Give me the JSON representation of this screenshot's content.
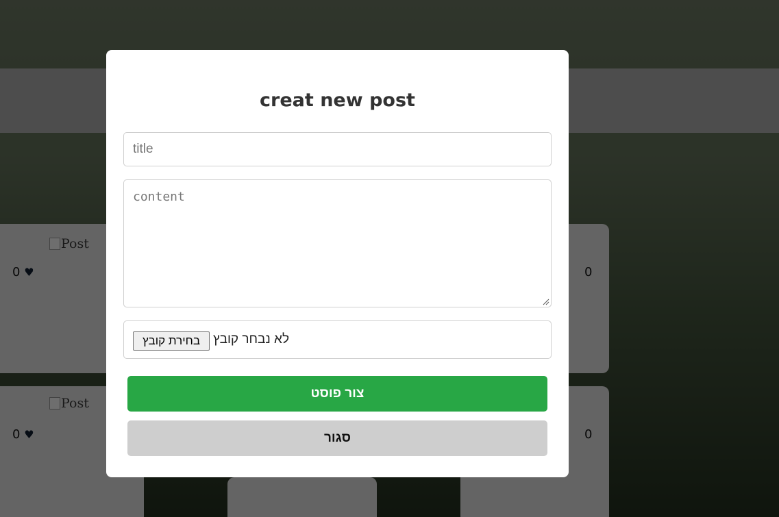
{
  "modal": {
    "title": "creat new post",
    "title_placeholder": "title",
    "content_placeholder": "content",
    "file_button_label": "בחירת קובץ",
    "file_status": "לא נבחר קובץ",
    "create_button": "צור פוסט",
    "close_button": "סגור"
  },
  "background": {
    "cards": [
      {
        "img_alt": "Post",
        "likes": "0",
        "heart": "♥"
      },
      {
        "img_alt": "",
        "likes": "0",
        "heart": ""
      },
      {
        "img_alt": "Post",
        "likes": "0",
        "heart": "♥"
      },
      {
        "img_alt": "",
        "likes": "0",
        "heart": ""
      }
    ]
  },
  "colors": {
    "create_button": "#28a745",
    "close_button": "#cecece"
  }
}
